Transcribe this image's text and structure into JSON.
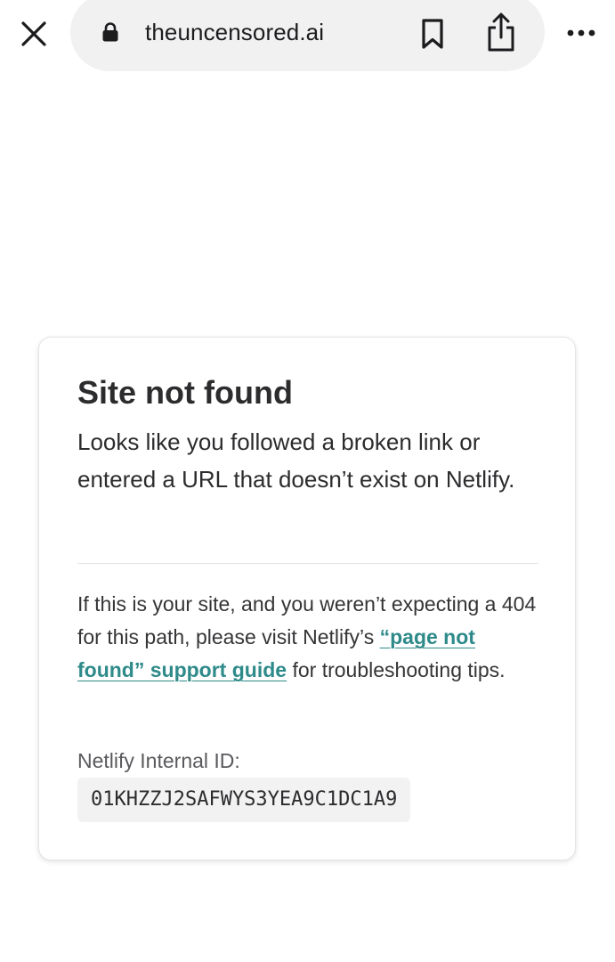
{
  "browser": {
    "url": "theuncensored.ai",
    "icons": {
      "close": "close-icon",
      "lock": "lock-icon",
      "bookmark": "bookmark-icon",
      "share": "share-icon",
      "more": "more-icon"
    }
  },
  "error_card": {
    "title": "Site not found",
    "intro": "Looks like you followed a broken link or entered a URL that doesn’t exist on Netlify.",
    "body_before_link": "If this is your site, and you weren’t expecting a 404 for this path, please visit Netlify’s ",
    "link_text": "“page not found” support guide",
    "body_after_link": " for troubleshooting tips.",
    "id_label": "Netlify Internal ID:",
    "id_value": "01KHZZJ2SAFWYS3YEA9C1DC1A9"
  },
  "colors": {
    "link": "#2f8a8a",
    "text": "#2c2c2e",
    "url_bar": "#f1f1f2",
    "code_bg": "#f2f2f3"
  }
}
